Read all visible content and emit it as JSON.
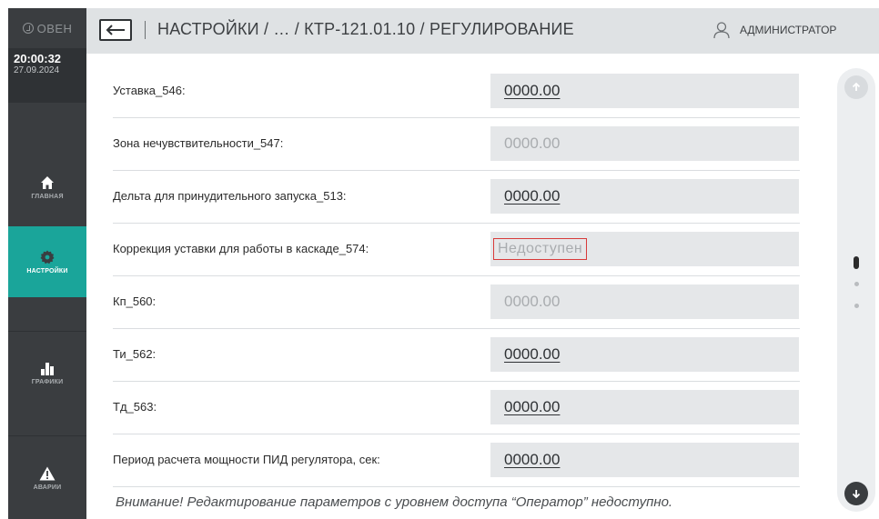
{
  "sidebar": {
    "logo": "ОВЕН",
    "time": "20:00:32",
    "date": "27.09.2024",
    "items": [
      {
        "label": "ГЛАВНАЯ",
        "icon": "home-icon"
      },
      {
        "label": "НАСТРОЙКИ",
        "icon": "gear-icon",
        "active": true
      },
      {
        "label": "ГРАФИКИ",
        "icon": "bar-chart-icon"
      },
      {
        "label": "АВАРИИ",
        "icon": "warning-icon"
      }
    ]
  },
  "header": {
    "title": "НАСТРОЙКИ / … / КТР-121.01.10 / РЕГУЛИРОВАНИЕ",
    "user": "АДМИНИСТРАТОР",
    "back_icon": "arrow-left-icon",
    "user_icon": "user-icon"
  },
  "rows": [
    {
      "label": "Уставка_546:",
      "value": "0000.00",
      "state": "editable"
    },
    {
      "label": "Зона нечувствительности_547:",
      "value": "0000.00",
      "state": "disabled"
    },
    {
      "label": "Дельта для принудительного  запуска_513:",
      "value": "0000.00",
      "state": "editable"
    },
    {
      "label": "Коррекция уставки для работы в каскаде_574:",
      "value": "Недоступен",
      "state": "unavailable"
    },
    {
      "label": "Кп_560:",
      "value": "0000.00",
      "state": "disabled"
    },
    {
      "label": "Ти_562:",
      "value": "0000.00",
      "state": "editable"
    },
    {
      "label": "Тд_563:",
      "value": "0000.00",
      "state": "editable"
    },
    {
      "label": "Период расчета мощности ПИД регулятора, сек:",
      "value": "0000.00",
      "state": "editable"
    }
  ],
  "warning": "Внимание! Редактирование параметров с уровнем доступа “Оператор” недоступно.",
  "colors": {
    "sidebar": "#3a3d40",
    "accent": "#1aa59a",
    "header": "#dfe2e4",
    "field": "#e5e7e9",
    "error_border": "#d83a3a"
  }
}
